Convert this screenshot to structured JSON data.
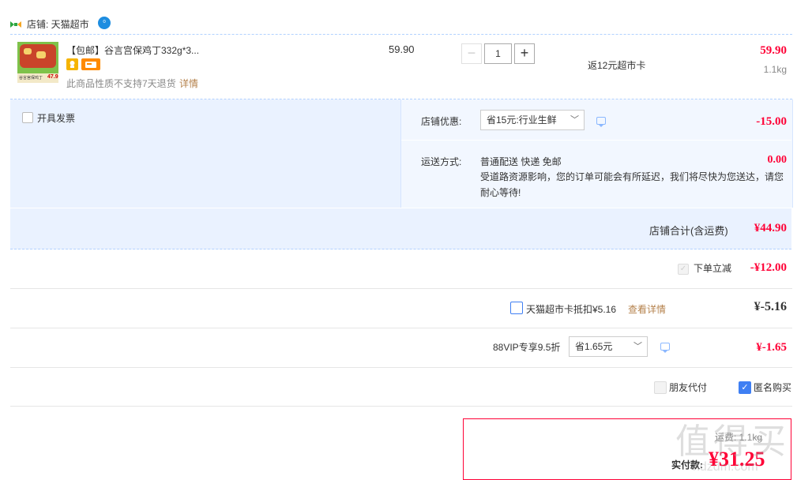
{
  "shop": {
    "label": "店铺: 天猫超市",
    "badge": "⁰"
  },
  "item": {
    "title": "【包邮】谷言宫保鸡丁332g*3...",
    "unit_price": "59.90",
    "quantity": "1",
    "rebate": "返12元超市卡",
    "subtotal": "59.90",
    "weight": "1.1kg",
    "no_return_note": "此商品性质不支持7天退货",
    "details_link": "详情",
    "thumb_price": "47.9",
    "thumb_caption": "谷言宫保鸡丁"
  },
  "invoice": {
    "label": "开具发票"
  },
  "shop_discount": {
    "label": "店铺优惠:",
    "selected": "省15元:行业生鲜",
    "amount": "-15.00"
  },
  "shipping": {
    "label": "运送方式:",
    "method": "普通配送 快递 免邮",
    "notice": "受道路资源影响，您的订单可能会有所延迟，我们将尽快为您送达，请您耐心等待!",
    "amount": "0.00"
  },
  "shop_total": {
    "label": "店铺合计(含运费)",
    "amount": "¥44.90"
  },
  "instant_discount": {
    "label": "下单立减",
    "amount": "-¥12.00"
  },
  "supermarket_card": {
    "label": "天猫超市卡抵扣¥5.16",
    "details_link": "查看详情",
    "amount": "¥-5.16"
  },
  "vip": {
    "label": "88VIP专享9.5折",
    "selected": "省1.65元",
    "amount": "¥-1.65"
  },
  "options": {
    "friend_pay": "朋友代付",
    "anonymous": "匿名购买"
  },
  "summary": {
    "partial_row": "运费: 1.1kg",
    "paid_label": "实付款:",
    "paid_amount": "¥31.25",
    "watermark": "值得买",
    "watermark_site": "hdzdm.com"
  },
  "colors": {
    "accent_red": "#ff0036",
    "section_bg": "#eaf2ff",
    "border_blue": "#b2d1ff",
    "link_brown": "#b4814b",
    "check_blue": "#3f7ff3"
  }
}
